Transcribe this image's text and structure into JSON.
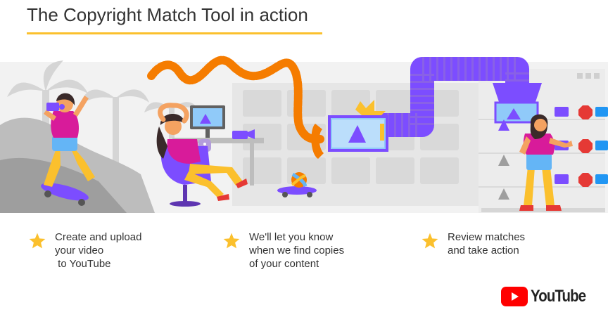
{
  "title": "The Copyright Match Tool in action",
  "steps": [
    {
      "text": "Create and upload\nyour video\n to YouTube",
      "icon": "star-icon"
    },
    {
      "text": "We'll let you know\nwhen we find copies\nof your content",
      "icon": "star-icon"
    },
    {
      "text": "Review matches\nand take action",
      "icon": "star-icon"
    }
  ],
  "logo": {
    "wordmark": "YouTube",
    "play_color": "#ff0000"
  },
  "colors": {
    "accent_yellow": "#fbc02d",
    "pipe_purple": "#7c4dff",
    "hose_orange": "#f57c00",
    "shirt_magenta": "#d81b9a",
    "scenery_grey": "#e0e0e0"
  }
}
